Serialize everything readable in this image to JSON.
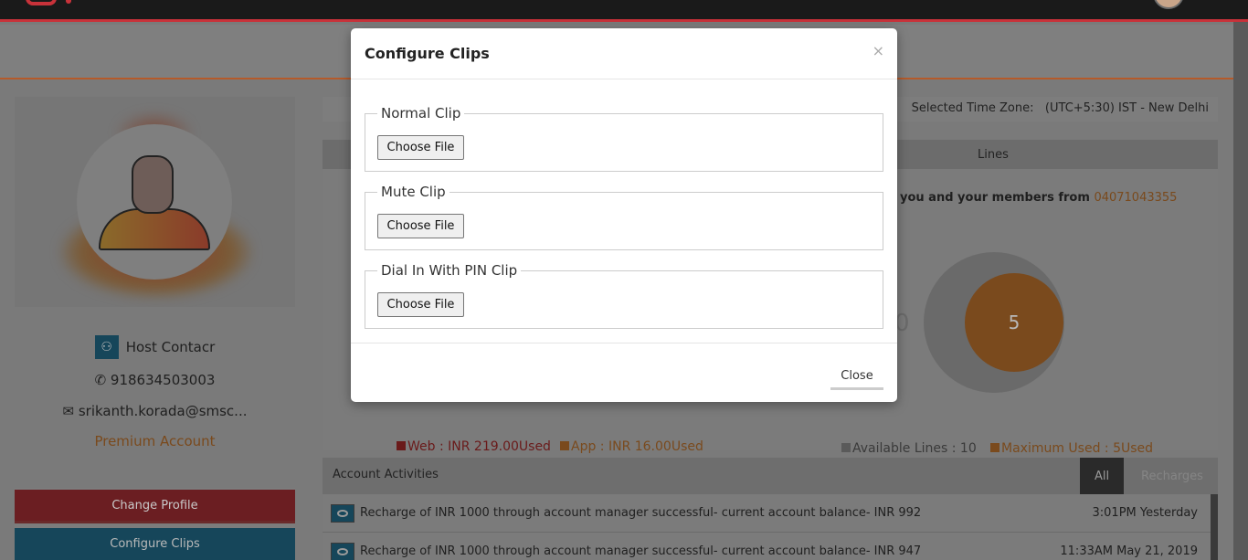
{
  "modal": {
    "title": "Configure Clips",
    "close_x": "×",
    "fields": [
      {
        "label": "Normal Clip",
        "button": "Choose File"
      },
      {
        "label": "Mute Clip",
        "button": "Choose File"
      },
      {
        "label": "Dial In With PIN Clip",
        "button": "Choose File"
      }
    ],
    "close_button": "Close"
  },
  "profile": {
    "name": "Host Contacr",
    "phone": "918634503003",
    "email": "srikanth.korada@smsc...",
    "account_type": "Premium Account",
    "change_profile": "Change Profile",
    "configure_clips": "Configure Clips"
  },
  "timezone": {
    "label": "Selected Time Zone:",
    "value": "(UTC+5:30) IST - New Delhi"
  },
  "lines": {
    "tab": "Lines",
    "members_text": "you and your members from",
    "members_number": "04071043355",
    "left_value": "0",
    "used_value": "5"
  },
  "legend": {
    "web": "Web : INR 219.00Used",
    "app": "App : INR 16.00Used",
    "available": "Available Lines : 10",
    "maximum": "Maximum Used : 5Used"
  },
  "activities": {
    "title": "Account Activities",
    "tabs": [
      "All",
      "Recharges"
    ],
    "rows": [
      {
        "message": "Recharge of INR 1000 through account manager successful- current account balance- INR 992",
        "time": "3:01PM Yesterday"
      },
      {
        "message": "Recharge of INR 1000 through account manager successful- current account balance- INR 947",
        "time": "11:33AM May 21, 2019"
      }
    ]
  },
  "colors": {
    "modal_bg": "#ffffff",
    "change_profile": "#c8323a",
    "configure_clips": "#2b8cb3",
    "accent_orange": "#e8962e"
  },
  "icons": {
    "user": "user-icon",
    "phone": "phone-icon",
    "mail": "envelope-icon",
    "money": "money-icon",
    "close": "close-icon"
  }
}
